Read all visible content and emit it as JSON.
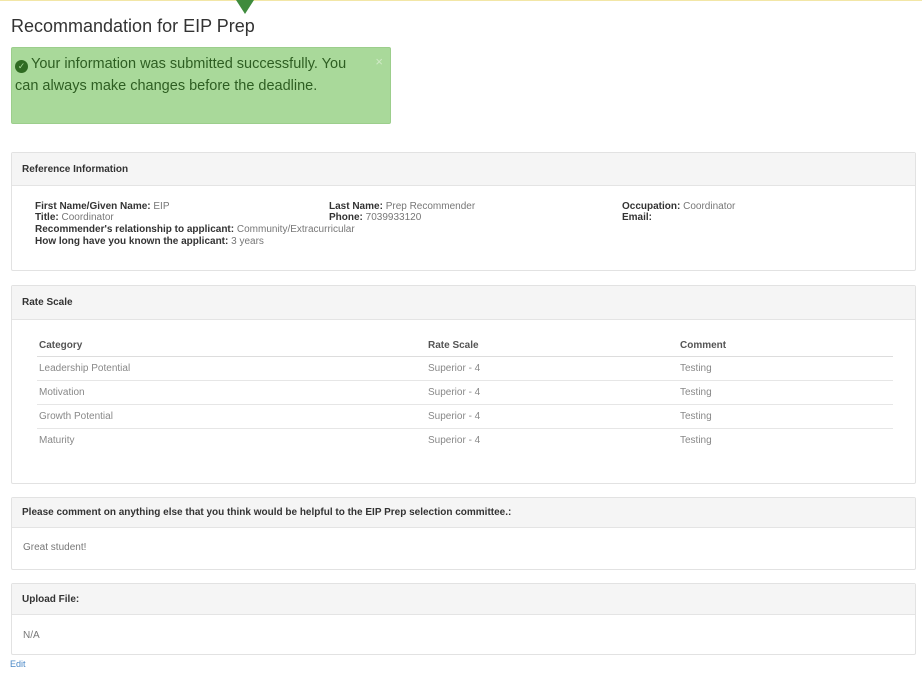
{
  "page": {
    "title": "Recommandation for EIP Prep"
  },
  "alert": {
    "message": "Your information was submitted successfully. You can always make changes before the deadline.",
    "close": "×"
  },
  "reference": {
    "heading": "Reference Information",
    "first_name_label": "First Name/Given Name:",
    "first_name_value": "EIP",
    "last_name_label": "Last Name:",
    "last_name_value": "Prep Recommender",
    "occupation_label": "Occupation:",
    "occupation_value": "Coordinator",
    "title_label": "Title:",
    "title_value": "Coordinator",
    "phone_label": "Phone:",
    "phone_value": "7039933120",
    "email_label": "Email:",
    "relationship_label": "Recommender's relationship to applicant:",
    "relationship_value": "Community/Extracurricular",
    "known_label": "How long have you known the applicant:",
    "known_value": "3 years"
  },
  "rate_scale": {
    "heading": "Rate Scale",
    "columns": [
      "Category",
      "Rate Scale",
      "Comment"
    ],
    "rows": [
      {
        "category": "Leadership Potential",
        "rate": "Superior - 4",
        "comment": "Testing"
      },
      {
        "category": "Motivation",
        "rate": "Superior - 4",
        "comment": "Testing"
      },
      {
        "category": "Growth Potential",
        "rate": "Superior - 4",
        "comment": "Testing"
      },
      {
        "category": "Maturity",
        "rate": "Superior - 4",
        "comment": "Testing"
      }
    ]
  },
  "comment": {
    "heading": "Please comment on anything else that you think would be helpful to the EIP Prep selection committee.:",
    "value": "Great student!"
  },
  "upload": {
    "heading": "Upload File:",
    "value": "N/A"
  },
  "edit_label": "Edit",
  "colors": {
    "alert_bg": "#a9d99a",
    "alert_text": "#2e5e22",
    "link": "#4a88c6"
  }
}
